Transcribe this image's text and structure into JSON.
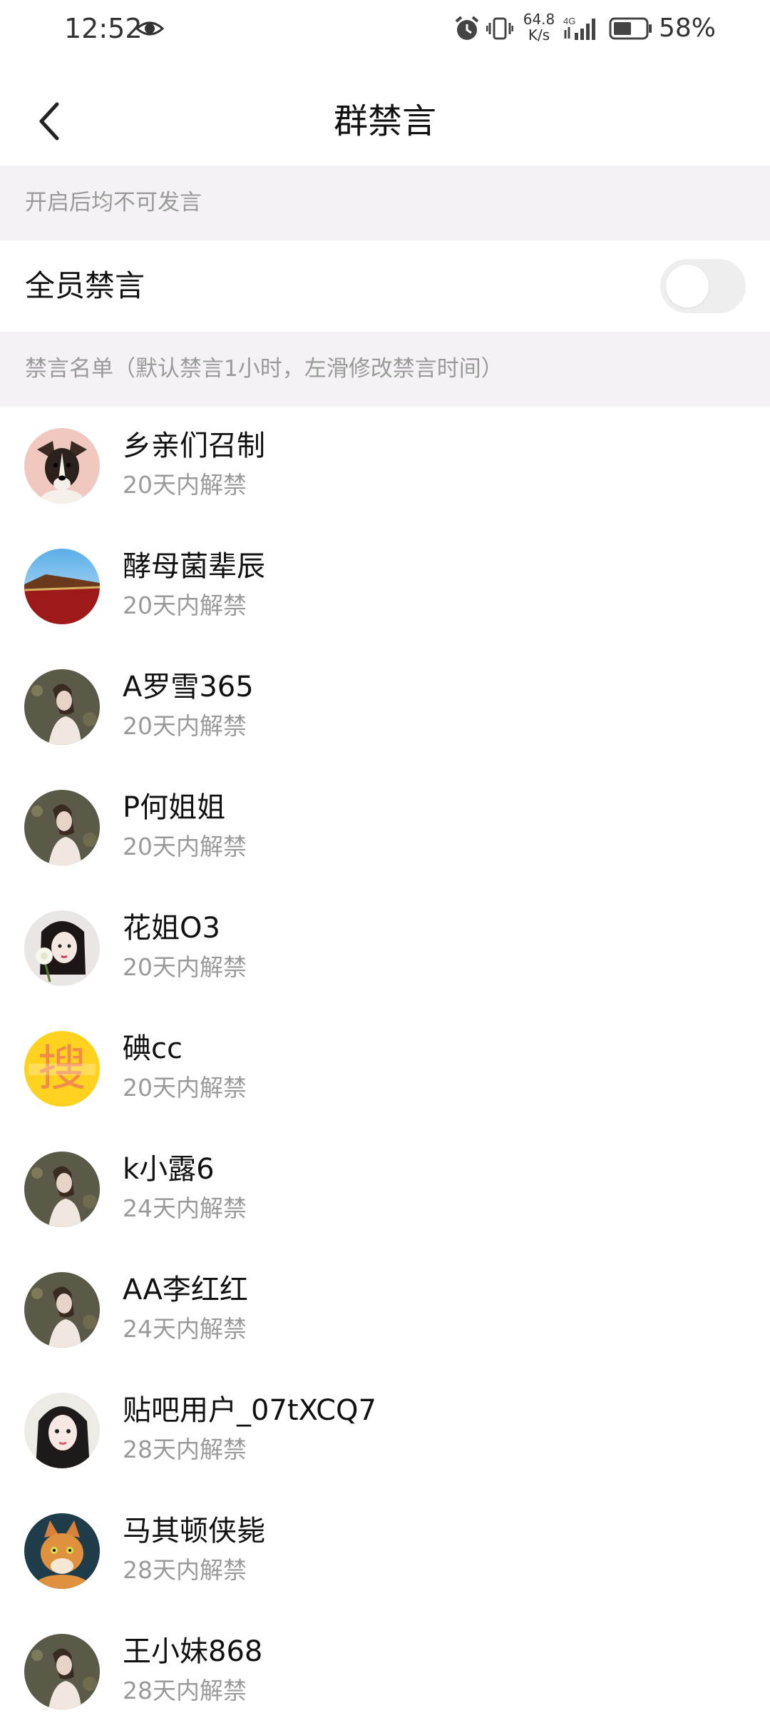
{
  "status_bar": {
    "time": "12:52",
    "net_speed_value": "64.8",
    "net_speed_unit": "K/s",
    "network_type": "4G",
    "battery_percent": "58%",
    "battery_level": 0.58
  },
  "header": {
    "title": "群禁言"
  },
  "sections": {
    "mute_all_hint": "开启后均不可发言",
    "muted_list_hint": "禁言名单（默认禁言1小时，左滑修改禁言时间）"
  },
  "mute_all": {
    "label": "全员禁言",
    "enabled": false
  },
  "muted_users": [
    {
      "name": "乡亲们召制",
      "status": "20天内解禁",
      "avatar": "dog"
    },
    {
      "name": "酵母菌辈辰",
      "status": "20天内解禁",
      "avatar": "palace-sky"
    },
    {
      "name": "A罗雪365",
      "status": "20天内解禁",
      "avatar": "woman-portrait"
    },
    {
      "name": "P何姐姐",
      "status": "20天内解禁",
      "avatar": "woman-portrait"
    },
    {
      "name": "花姐O3",
      "status": "20天内解禁",
      "avatar": "woman-flower"
    },
    {
      "name": "碘cc",
      "status": "20天内解禁",
      "avatar": "yellow-character"
    },
    {
      "name": "k小露6",
      "status": "24天内解禁",
      "avatar": "woman-portrait"
    },
    {
      "name": "AA李红红",
      "status": "24天内解禁",
      "avatar": "woman-portrait"
    },
    {
      "name": "贴吧用户_07tXCQ7",
      "status": "28天内解禁",
      "avatar": "woman-face"
    },
    {
      "name": "马其顿侠毙",
      "status": "28天内解禁",
      "avatar": "cat"
    },
    {
      "name": "王小妹868",
      "status": "28天内解禁",
      "avatar": "woman-portrait"
    }
  ],
  "colors": {
    "section_bg": "#f5f2f5",
    "hint_text": "#9a9a9a",
    "toggle_off": "#eeeeee"
  }
}
